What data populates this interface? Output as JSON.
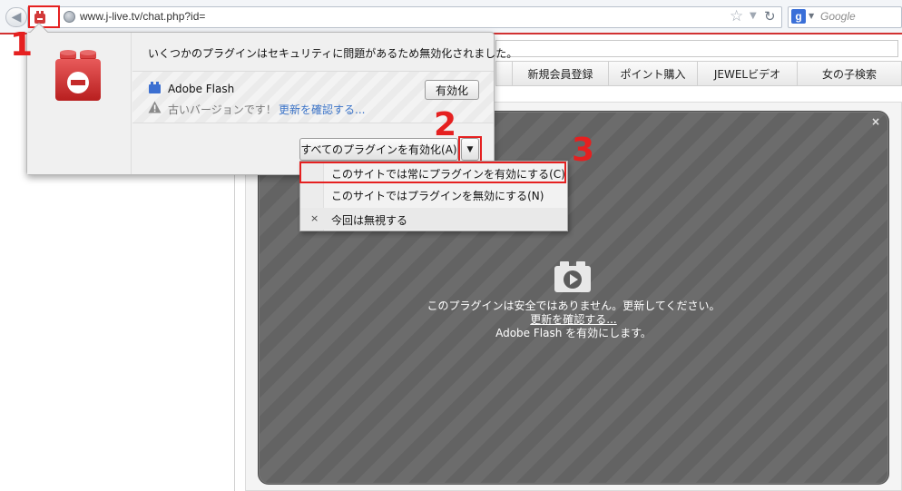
{
  "browser": {
    "url": "www.j-live.tv/chat.php?id=",
    "search_placeholder": "Google"
  },
  "annotations": {
    "step1": "1",
    "step2": "2",
    "step3": "3"
  },
  "popup": {
    "message": "いくつかのプラグインはセキュリティに問題があるため無効化されました。",
    "plugin_name": "Adobe Flash",
    "warning_text": "古いバージョンです！",
    "update_link": "更新を確認する...",
    "enable_button": "有効化",
    "enable_all_button": "すべてのプラグインを有効化(A)",
    "menu": [
      {
        "label": "このサイトでは常にプラグインを有効にする(C)",
        "mark": ""
      },
      {
        "label": "このサイトではプラグインを無効にする(N)",
        "mark": ""
      },
      {
        "label": "今回は無視する",
        "mark": "×"
      }
    ]
  },
  "nav": {
    "items": [
      "新規会員登録",
      "ポイント購入",
      "JEWELビデオ",
      "女の子検索"
    ]
  },
  "plugin_area": {
    "line1": "このプラグインは安全ではありません。更新してください。",
    "link": "更新を確認する...",
    "line3": "Adobe Flash を有効にします。",
    "close": "×"
  }
}
